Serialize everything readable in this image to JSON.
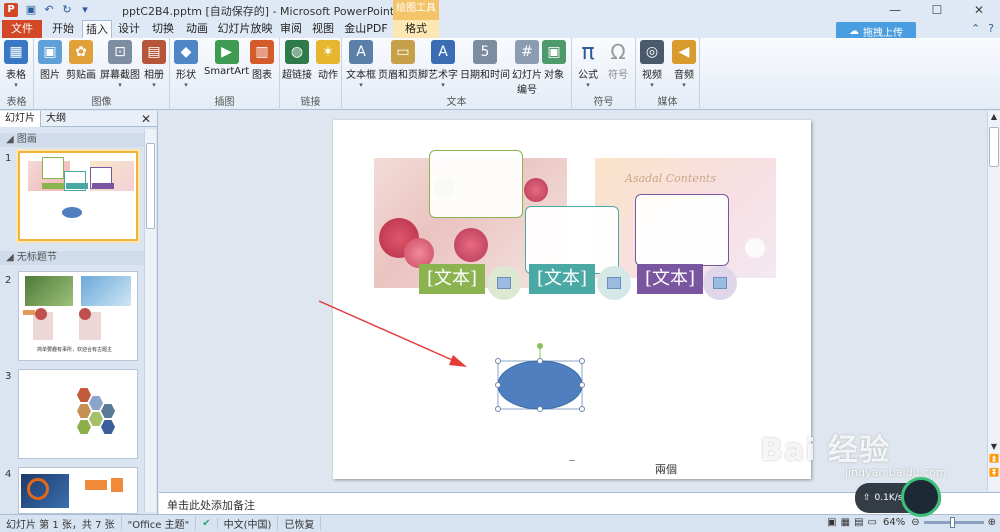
{
  "title": {
    "text": "pptC2B4.pptm [自动保存的] - Microsoft PowerPoint",
    "context_group": "绘图工具"
  },
  "tabs": [
    "文件",
    "开始",
    "插入",
    "设计",
    "切换",
    "动画",
    "幻灯片放映",
    "审阅",
    "视图",
    "金山PDF",
    "格式"
  ],
  "upload_button": "拖拽上传",
  "ribbon": {
    "groups": [
      {
        "label": "表格",
        "buttons": [
          "表格"
        ]
      },
      {
        "label": "图像",
        "buttons": [
          "图片",
          "剪贴画",
          "屏幕截图",
          "相册"
        ]
      },
      {
        "label": "插图",
        "buttons": [
          "形状",
          "SmartArt",
          "图表"
        ]
      },
      {
        "label": "链接",
        "buttons": [
          "超链接",
          "动作"
        ]
      },
      {
        "label": "文本",
        "buttons": [
          "文本框",
          "页眉和页脚",
          "艺术字",
          "日期和时间",
          "幻灯片编号",
          "对象"
        ]
      },
      {
        "label": "符号",
        "buttons": [
          "公式",
          "符号"
        ]
      },
      {
        "label": "媒体",
        "buttons": [
          "视频",
          "音频"
        ]
      }
    ]
  },
  "left_panel": {
    "tabs": [
      "幻灯片",
      "大纲"
    ],
    "sections": [
      "图画",
      "无标题节"
    ],
    "thumb_numbers": [
      "1",
      "2",
      "3",
      "4"
    ],
    "thumb2_caption": "简单要趣有事所，欢迎合有古题主"
  },
  "slide": {
    "cards": [
      {
        "label": "[文本]",
        "color": "#8bb34f"
      },
      {
        "label": "[文本]",
        "color": "#4aa9a4"
      },
      {
        "label": "[文本]",
        "color": "#7a55a0"
      }
    ],
    "header_script": "Asadal Contents",
    "footer_text": "兩個"
  },
  "notes_placeholder": "单击此处添加备注",
  "status": {
    "slide_info": "幻灯片 第 1 张，共 7 张",
    "theme": "\"Office 主题\"",
    "language": "中文(中国)",
    "restored": "已恢复",
    "zoom": "64%"
  },
  "watermark": {
    "main": "Bai 经验",
    "sub": "jingyan.baidu.com"
  },
  "net_widget": {
    "speed": "0.1K/s"
  }
}
